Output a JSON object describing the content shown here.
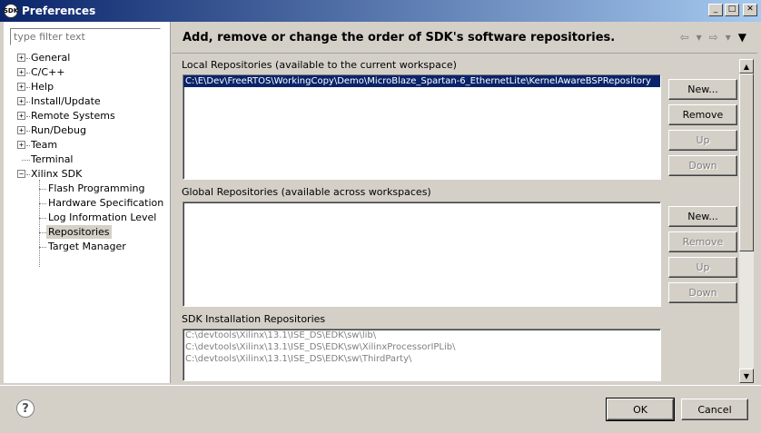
{
  "window": {
    "title": "Preferences",
    "icon_text": "SDK",
    "minimize_glyph": "_",
    "maximize_glyph": "□",
    "close_glyph": "✕"
  },
  "filter": {
    "placeholder": "type filter text",
    "value": ""
  },
  "tree": {
    "items": [
      {
        "label": "General",
        "expander": "+"
      },
      {
        "label": "C/C++",
        "expander": "+"
      },
      {
        "label": "Help",
        "expander": "+"
      },
      {
        "label": "Install/Update",
        "expander": "+"
      },
      {
        "label": "Remote Systems",
        "expander": "+"
      },
      {
        "label": "Run/Debug",
        "expander": "+"
      },
      {
        "label": "Team",
        "expander": "+"
      },
      {
        "label": "Terminal",
        "expander": ""
      },
      {
        "label": "Xilinx SDK",
        "expander": "−"
      }
    ],
    "children": [
      {
        "label": "Flash Programming"
      },
      {
        "label": "Hardware Specification"
      },
      {
        "label": "Log Information Level"
      },
      {
        "label": "Repositories",
        "selected": true
      },
      {
        "label": "Target Manager"
      }
    ]
  },
  "page": {
    "title": "Add, remove or change the order of SDK's software repositories.",
    "nav_back": "⇦",
    "nav_forward": "⇨",
    "nav_dropdown": "▾",
    "view_menu": "▼"
  },
  "local": {
    "label": "Local Repositories (available to the current workspace)",
    "rows": [
      "C:\\E\\Dev\\FreeRTOS\\WorkingCopy\\Demo\\MicroBlaze_Spartan-6_EthernetLite\\KernelAwareBSPRepository"
    ],
    "buttons": {
      "new": "New...",
      "remove": "Remove",
      "up": "Up",
      "down": "Down"
    }
  },
  "global": {
    "label": "Global Repositories (available across workspaces)",
    "rows": [],
    "buttons": {
      "new": "New...",
      "remove": "Remove",
      "up": "Up",
      "down": "Down"
    }
  },
  "sdk": {
    "label": "SDK Installation Repositories",
    "rows": [
      "C:\\devtools\\Xilinx\\13.1\\ISE_DS\\EDK\\sw\\lib\\",
      "C:\\devtools\\Xilinx\\13.1\\ISE_DS\\EDK\\sw\\XilinxProcessorIPLib\\",
      "C:\\devtools\\Xilinx\\13.1\\ISE_DS\\EDK\\sw\\ThirdParty\\"
    ]
  },
  "scrollbar": {
    "up_glyph": "▲",
    "down_glyph": "▼"
  },
  "dialog": {
    "help_glyph": "?",
    "ok": "OK",
    "cancel": "Cancel"
  },
  "colors": {
    "selection": "#0a246a",
    "titlebar_start": "#0a246a",
    "titlebar_end": "#a6caf0",
    "face": "#d4d0c8"
  }
}
